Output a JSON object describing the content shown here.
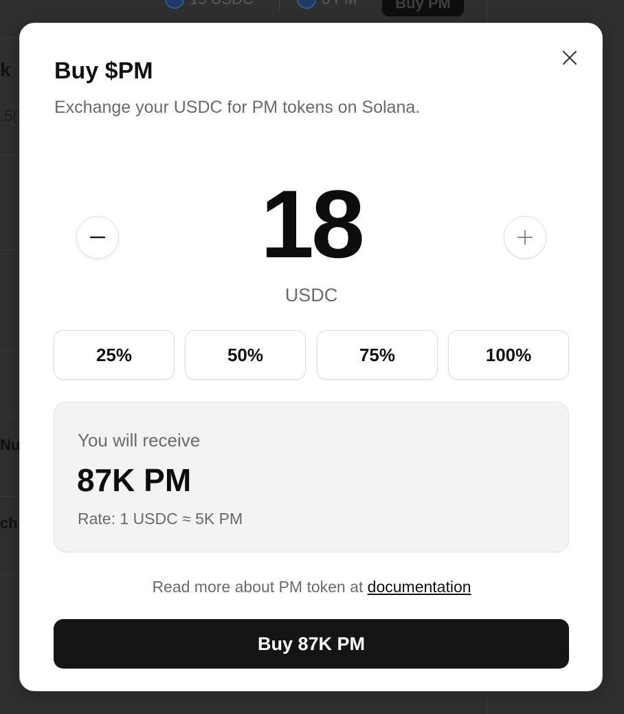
{
  "background": {
    "topbar": {
      "usdc_balance": "15 USDC",
      "pm_balance": "0 PM",
      "buy_button_label": "Buy PM"
    },
    "left_fragments": [
      "k",
      ".5(",
      "",
      "",
      "",
      "Nu",
      "ch"
    ]
  },
  "modal": {
    "title": "Buy $PM",
    "subtitle": "Exchange your USDC for PM tokens on Solana.",
    "amount": "18",
    "currency": "USDC",
    "percent_options": [
      "25%",
      "50%",
      "75%",
      "100%"
    ],
    "receive": {
      "label": "You will receive",
      "amount": "87K PM",
      "rate": "Rate: 1 USDC ≈ 5K PM"
    },
    "docs": {
      "text": "Read more about PM token at ",
      "link_label": "documentation"
    },
    "buy_button_label": "Buy 87K PM"
  },
  "icons": {
    "close": "close-icon",
    "minus": "minus-icon",
    "plus": "plus-icon"
  }
}
